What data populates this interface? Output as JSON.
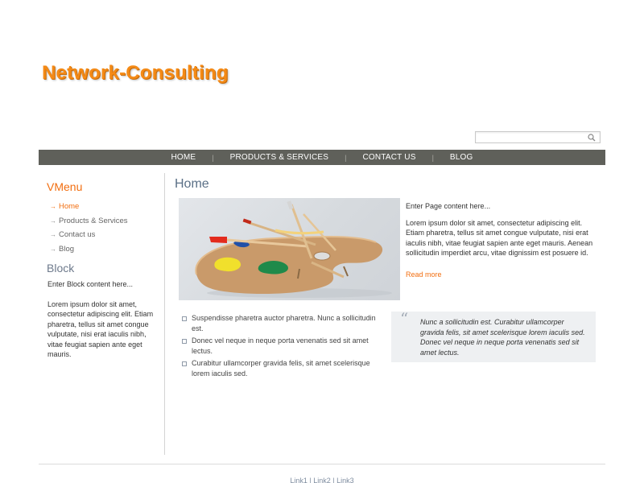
{
  "header": {
    "logo_text": "Network-Consulting",
    "search_placeholder": "",
    "search_icon": "magnifier-icon"
  },
  "nav": {
    "items": [
      {
        "label": "HOME"
      },
      {
        "label": "PRODUCTS & SERVICES"
      },
      {
        "label": "CONTACT US"
      },
      {
        "label": "BLOG"
      }
    ],
    "separator": "|"
  },
  "sidebar": {
    "vmenu_title": "VMenu",
    "vmenu_items": [
      {
        "label": "Home",
        "active": true
      },
      {
        "label": "Products & Services",
        "active": false
      },
      {
        "label": "Contact us",
        "active": false
      },
      {
        "label": "Blog",
        "active": false
      }
    ],
    "arrow": "→",
    "block_title": "Block",
    "block_intro": "Enter Block content here...",
    "block_body": "Lorem ipsum dolor sit amet, consectetur adipiscing elit. Etiam pharetra, tellus sit amet congue vulputate, nisi erat iaculis nibh, vitae feugiat sapien ante eget mauris."
  },
  "main": {
    "title": "Home",
    "intro": "Enter Page content here...",
    "body": "Lorem ipsum dolor sit amet, consectetur adipiscing elit. Etiam pharetra, tellus sit amet congue vulputate, nisi erat iaculis nibh, vitae feugiat sapien ante eget mauris. Aenean sollicitudin imperdiet arcu, vitae dignissim est posuere id.",
    "read_more": "Read more",
    "bullets": [
      "Suspendisse pharetra auctor pharetra. Nunc a sollicitudin est.",
      "Donec vel neque in neque porta venenatis sed sit amet lectus.",
      "Curabitur ullamcorper gravida felis, sit amet scelerisque lorem iaculis sed."
    ],
    "quote": "Nunc a sollicitudin est. Curabitur ullamcorper gravida felis, sit amet scelerisque lorem iaculis sed. Donec vel neque in neque porta venenatis sed sit amet lectus.",
    "quote_mark": "“"
  },
  "footer": {
    "links": [
      "Link1",
      "Link2",
      "Link3"
    ],
    "separator": " | "
  },
  "colors": {
    "logo": "#f48a16",
    "accent": "#f26e10",
    "nav_bg": "#5f605a",
    "heading_blue": "#5a6f86",
    "quote_bg": "#eef0f2"
  }
}
